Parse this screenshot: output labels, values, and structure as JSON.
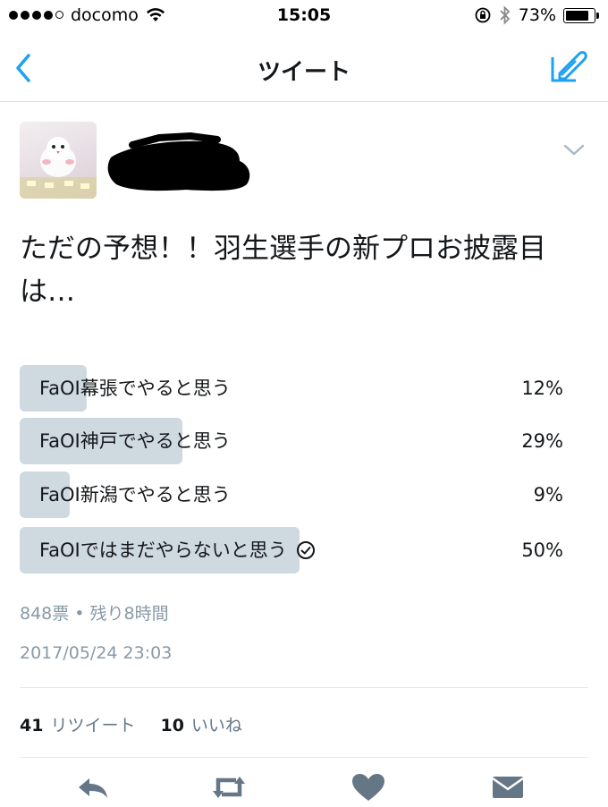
{
  "status_bar": {
    "carrier": "docomo",
    "time": "15:05",
    "battery": "73%",
    "signal_bars_filled": 4,
    "signal_bars_total": 5,
    "battery_level": 0.73
  },
  "nav": {
    "title": "ツイート",
    "back_icon": "chevron-left-icon",
    "compose_icon": "compose-icon"
  },
  "tweet": {
    "text": "ただの予想！！羽生選手の新プロお披露目は…",
    "poll": {
      "options": [
        {
          "label": "FaOI幕張でやると思う",
          "percent": "12%",
          "fraction": 0.12,
          "selected": false
        },
        {
          "label": "FaOI神戸でやると思う",
          "percent": "29%",
          "fraction": 0.29,
          "selected": false
        },
        {
          "label": "FaOI新潟でやると思う",
          "percent": "9%",
          "fraction": 0.09,
          "selected": false
        },
        {
          "label": "FaOIではまだやらないと思う",
          "percent": "50%",
          "fraction": 0.5,
          "selected": true
        }
      ],
      "summary": "848票 • 残り8時間"
    },
    "timestamp": "2017/05/24 23:03",
    "stats": {
      "retweets_count": "41",
      "retweets_label": "リツイート",
      "likes_count": "10",
      "likes_label": "いいね"
    }
  },
  "actions": [
    "reply-icon",
    "retweet-icon",
    "like-icon",
    "dm-icon"
  ],
  "colors": {
    "accent": "#1da1f2",
    "poll_bar": "#cfd9e0",
    "muted_text": "#8899a6",
    "action_icon": "#657786"
  }
}
